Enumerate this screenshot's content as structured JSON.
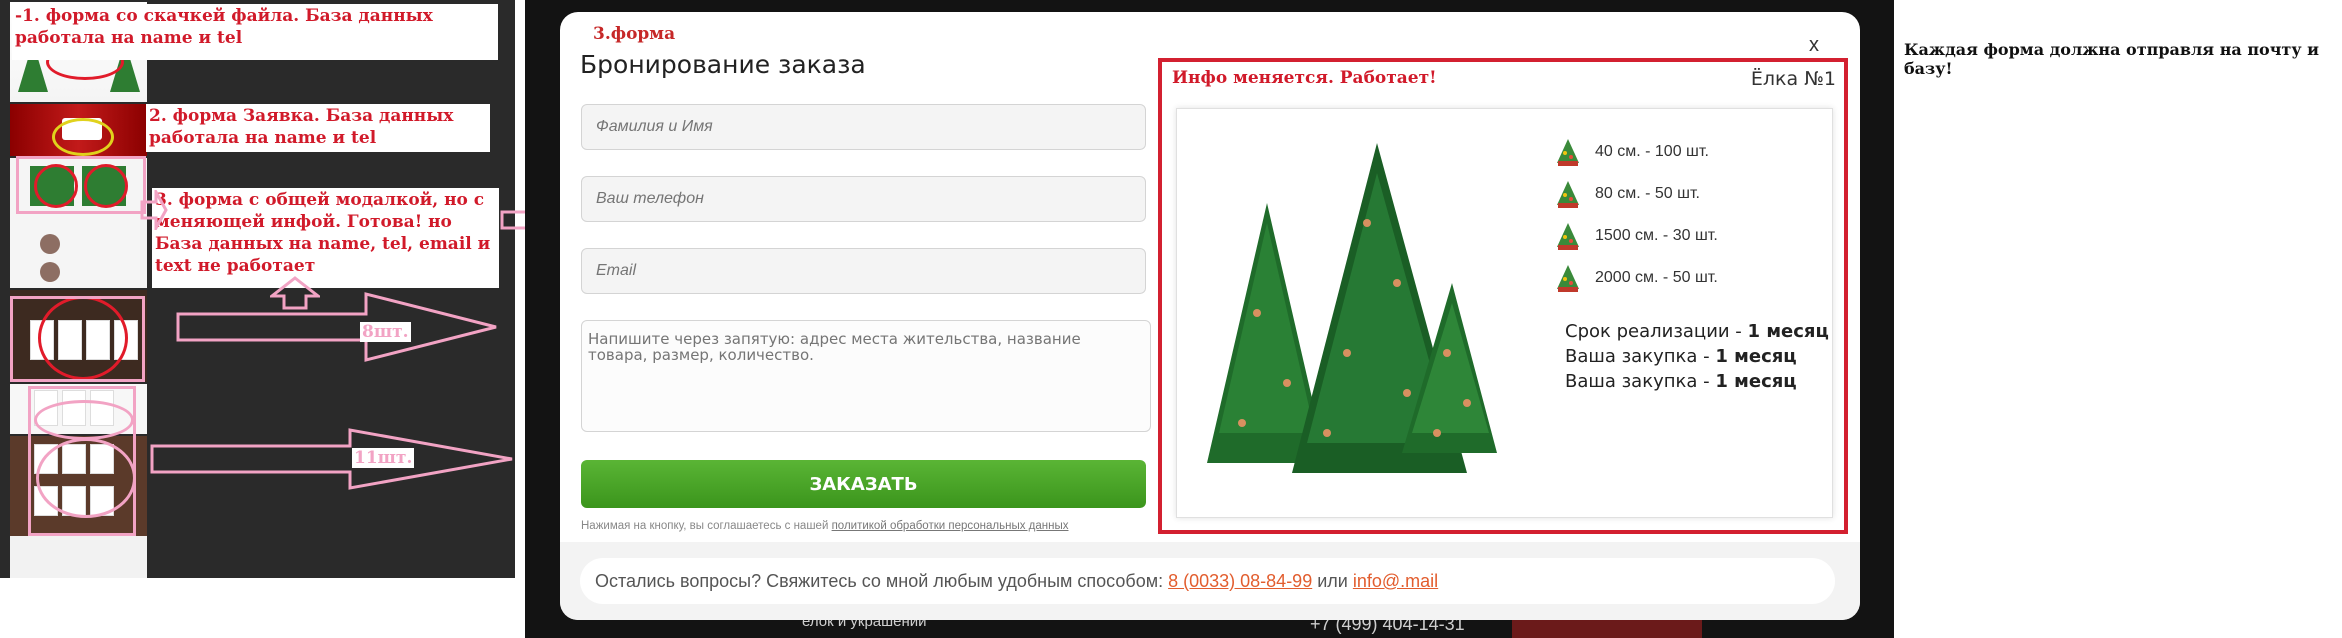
{
  "annotations": {
    "note1": "-1. форма со скачкей файла. База данных работала на name и tel",
    "note2": "2. форма Заявка. База данных работала на name и tel",
    "note3": "3. форма с общей модалкой, но с меняющей инфой. Готова! но База данных на name, tel, email и text не работает",
    "count1": "8шт.",
    "count2": "11шт.",
    "right_note": "Каждая форма должна отправля на почту и базу!"
  },
  "modal": {
    "form_tag": "3.форма",
    "title": "Бронирование заказа",
    "close": "x",
    "fields": {
      "name_placeholder": "Фамилия и Имя",
      "phone_placeholder": "Ваш телефон",
      "email_placeholder": "Email",
      "message_placeholder": "Напишите через запятую: адрес места жительства, название товара, размер, количество."
    },
    "submit_label": "ЗАКАЗАТЬ",
    "consent_text": "Нажимая на кнопку, вы соглашаетесь с нашей",
    "consent_link": "политикой обработки персональных данных",
    "contact": {
      "text": "Остались вопросы? Свяжитесь со мной любым удобным способом:",
      "phone": "8 (0033) 08-84-99",
      "or": "или",
      "email": "info@.mail"
    }
  },
  "info": {
    "note": "Инфо меняется. Работает!",
    "title": "Ёлка №1",
    "sizes": [
      {
        "label": "40 см. - 100 шт."
      },
      {
        "label": "80 см. - 50 шт."
      },
      {
        "label": "1500 см. - 30 шт."
      },
      {
        "label": "2000 см. - 50 шт."
      }
    ],
    "terms": [
      {
        "label": "Срок реализации -",
        "value": "1 месяц"
      },
      {
        "label": "Ваша закупка -",
        "value": "1 месяц"
      },
      {
        "label": "Ваша закупка -",
        "value": "1 месяц"
      }
    ]
  },
  "background": {
    "bottom_text": "елок и украшений",
    "phone": "+7 (499) 404-14-31"
  },
  "colors": {
    "annotation_red": "#d11a2a",
    "annotation_pink": "#f2a3c4",
    "button_green": "#4aa52a",
    "accent_orange": "#e25d2e"
  }
}
